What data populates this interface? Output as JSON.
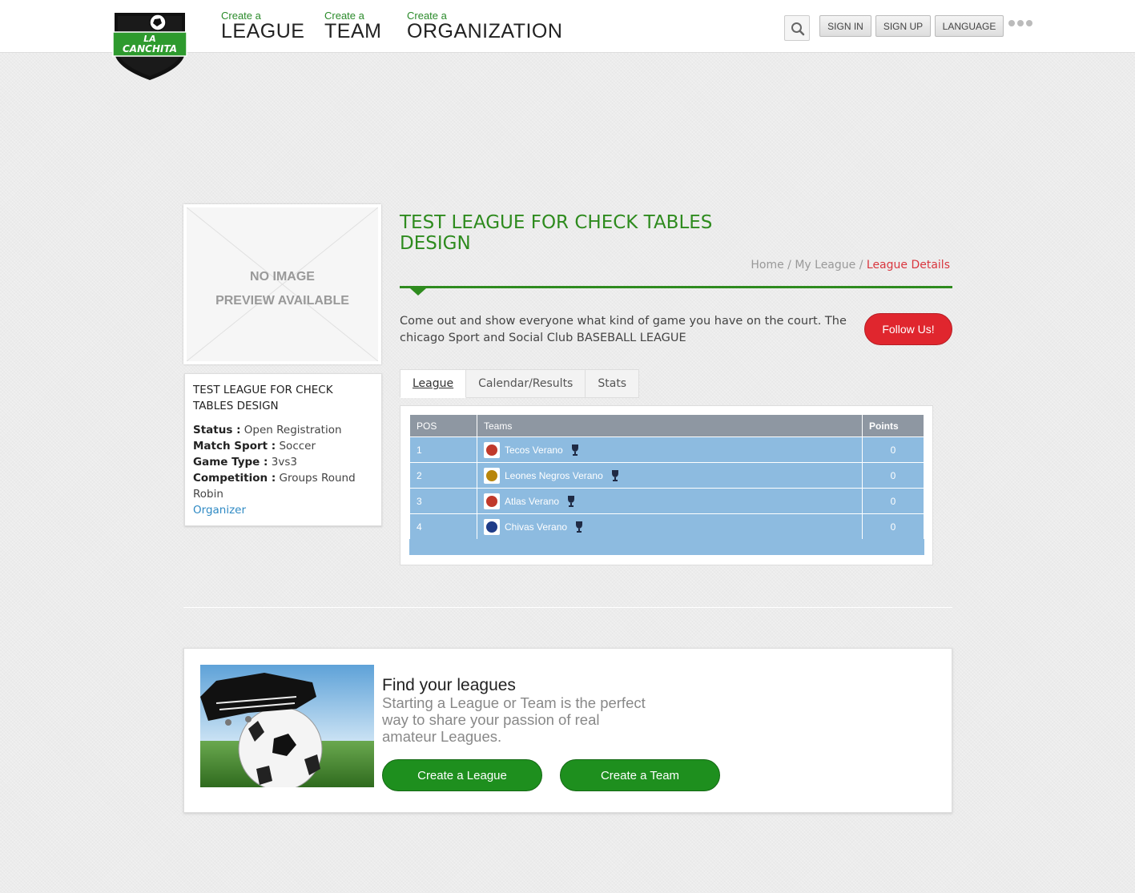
{
  "header": {
    "logo_text": "LA CANCHITA",
    "nav": [
      {
        "small": "Create a",
        "big": "LEAGUE"
      },
      {
        "small": "Create a",
        "big": "TEAM"
      },
      {
        "small": "Create a",
        "big": "ORGANIZATION"
      }
    ],
    "sign_in": "SIGN IN",
    "sign_up": "SIGN UP",
    "language": "LANGUAGE"
  },
  "image_placeholder": {
    "line1": "NO IMAGE",
    "line2": "PREVIEW AVAILABLE"
  },
  "info": {
    "title": "TEST LEAGUE FOR CHECK TABLES DESIGN",
    "status_label": "Status :",
    "status_value": "Open Registration",
    "sport_label": "Match Sport :",
    "sport_value": "Soccer",
    "game_type_label": "Game Type :",
    "game_type_value": "3vs3",
    "competition_label": "Competition :",
    "competition_value": "Groups Round Robin",
    "organizer_link": "Organizer"
  },
  "league": {
    "title": "TEST LEAGUE FOR CHECK TABLES DESIGN",
    "breadcrumb": {
      "home": "Home",
      "sep": "/",
      "my_league": "My League",
      "current": "League Details"
    },
    "description": "Come out and show everyone what kind of game you have on the court. The chicago Sport and Social Club BASEBALL LEAGUE",
    "follow_label": "Follow Us!",
    "tabs": [
      "League",
      "Calendar/Results",
      "Stats"
    ]
  },
  "standings": {
    "headers": {
      "pos": "POS",
      "teams": "Teams",
      "points": "Points"
    },
    "rows": [
      {
        "pos": "1",
        "team": "Tecos Verano",
        "points": "0",
        "badge_color": "#c0392b"
      },
      {
        "pos": "2",
        "team": "Leones Negros Verano",
        "points": "0",
        "badge_color": "#b8860b"
      },
      {
        "pos": "3",
        "team": "Atlas Verano",
        "points": "0",
        "badge_color": "#c0392b"
      },
      {
        "pos": "4",
        "team": "Chivas Verano",
        "points": "0",
        "badge_color": "#1f3c88"
      }
    ]
  },
  "promo": {
    "title": "Find your leagues",
    "text": "Starting a League or Team is the perfect way to share your passion of real amateur Leagues.",
    "create_league": "Create a League",
    "create_team": "Create a Team"
  }
}
